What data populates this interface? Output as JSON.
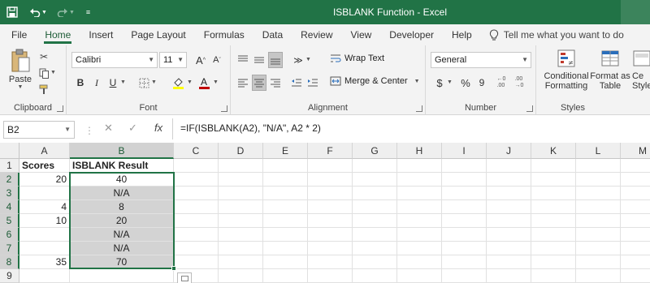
{
  "window": {
    "title": "ISBLANK Function  -  Excel"
  },
  "tabs": [
    "File",
    "Home",
    "Insert",
    "Page Layout",
    "Formulas",
    "Data",
    "Review",
    "View",
    "Developer",
    "Help"
  ],
  "active_tab": "Home",
  "tell_me": "Tell me what you want to do",
  "ribbon": {
    "clipboard": {
      "label": "Clipboard",
      "paste": "Paste"
    },
    "font": {
      "label": "Font",
      "name": "Calibri",
      "size": "11"
    },
    "alignment": {
      "label": "Alignment",
      "wrap_text": "Wrap Text",
      "merge_center": "Merge & Center"
    },
    "number": {
      "label": "Number",
      "format": "General",
      "currency": "$",
      "percent": "%",
      "comma": "9"
    },
    "styles": {
      "label": "Styles",
      "conditional_1": "Conditional",
      "conditional_2": "Formatting",
      "format_as_1": "Format as",
      "format_as_2": "Table",
      "cell_1": "Ce",
      "cell_2": "Style"
    }
  },
  "formula_bar": {
    "name_box": "B2",
    "formula": "=IF(ISBLANK(A2), \"N/A\", A2 * 2)"
  },
  "columns": [
    "A",
    "B",
    "C",
    "D",
    "E",
    "F",
    "G",
    "H",
    "I",
    "J",
    "K",
    "L",
    "M"
  ],
  "rows": [
    "1",
    "2",
    "3",
    "4",
    "5",
    "6",
    "7",
    "8",
    "9"
  ],
  "sheet": {
    "header_a": "Scores",
    "header_b": "ISBLANK Result",
    "a_values": [
      "20",
      "",
      "4",
      "10",
      "",
      "",
      "35",
      ""
    ],
    "b_values": [
      "40",
      "N/A",
      "8",
      "20",
      "N/A",
      "N/A",
      "70",
      ""
    ]
  },
  "colors": {
    "accent": "#217346",
    "selection_fill": "#d3d3d3"
  }
}
